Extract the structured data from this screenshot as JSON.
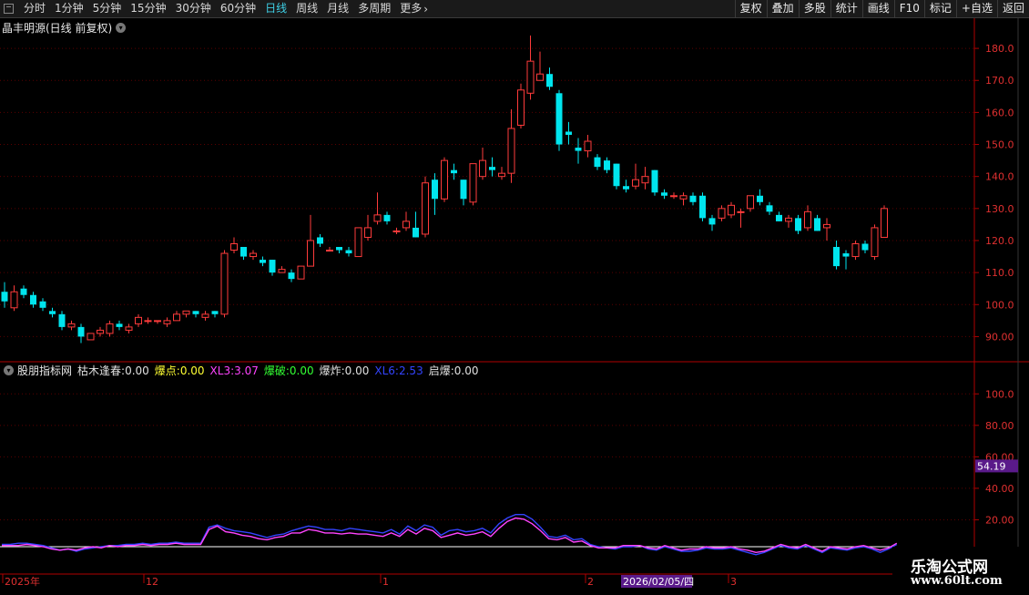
{
  "toolbar": {
    "tabs": [
      "分时",
      "1分钟",
      "5分钟",
      "15分钟",
      "30分钟",
      "60分钟",
      "日线",
      "周线",
      "月线",
      "多周期",
      "更多"
    ],
    "active_tab": "日线",
    "buttons": [
      "复权",
      "叠加",
      "多股",
      "统计",
      "画线",
      "F10",
      "标记",
      "+自选",
      "返回"
    ]
  },
  "main_panel": {
    "title": "晶丰明源(日线 前复权)",
    "y_ticks": [
      "180.0",
      "170.0",
      "160.0",
      "150.0",
      "140.0",
      "130.0",
      "120.0",
      "110.0",
      "100.0",
      "90.00"
    ]
  },
  "indicator_panel": {
    "title": "股朋指标网",
    "items": [
      {
        "label": "枯木逢春:",
        "value": "0.00",
        "color": "#e0e0e0"
      },
      {
        "label": "爆点:",
        "value": "0.00",
        "color": "#ffff33"
      },
      {
        "label": "XL3:",
        "value": "3.07",
        "color": "#ff44ff"
      },
      {
        "label": "爆破:",
        "value": "0.00",
        "color": "#33ff33"
      },
      {
        "label": "爆炸:",
        "value": "0.00",
        "color": "#e0e0e0"
      },
      {
        "label": "XL6:",
        "value": "2.53",
        "color": "#3344ff"
      },
      {
        "label": "启爆:",
        "value": "0.00",
        "color": "#e0e0e0"
      }
    ],
    "y_ticks": [
      "100.0",
      "80.00",
      "60.00",
      "40.00",
      "20.00"
    ],
    "current_value": "54.19"
  },
  "x_axis": {
    "labels": [
      "2025年",
      "12",
      "1",
      "2",
      "3"
    ],
    "cursor_date": "2026/02/05/四"
  },
  "watermark": {
    "line1": "乐淘公式网",
    "line2": "www.60lt.com"
  },
  "colors": {
    "up": "#ff3b3b",
    "down": "#00e5ee",
    "xl3": "#ff44ff",
    "xl6": "#3344ff",
    "grid": "#5a0000",
    "axis": "#b00000"
  },
  "chart_data": [
    {
      "type": "candlestick",
      "title": "晶丰明源(日线 前复权)",
      "ylim": [
        85,
        186
      ],
      "candles": [
        {
          "o": 104,
          "h": 107,
          "l": 99,
          "c": 101
        },
        {
          "o": 99,
          "h": 106,
          "l": 98,
          "c": 104
        },
        {
          "o": 105,
          "h": 106,
          "l": 102,
          "c": 103
        },
        {
          "o": 103,
          "h": 104,
          "l": 99,
          "c": 100
        },
        {
          "o": 101,
          "h": 102,
          "l": 98,
          "c": 99
        },
        {
          "o": 98,
          "h": 99,
          "l": 96,
          "c": 97
        },
        {
          "o": 97,
          "h": 98,
          "l": 92,
          "c": 93
        },
        {
          "o": 93,
          "h": 95,
          "l": 92,
          "c": 94
        },
        {
          "o": 93,
          "h": 94,
          "l": 88,
          "c": 90
        },
        {
          "o": 89,
          "h": 91,
          "l": 89,
          "c": 91
        },
        {
          "o": 91,
          "h": 93,
          "l": 90,
          "c": 92
        },
        {
          "o": 91,
          "h": 95,
          "l": 90,
          "c": 94
        },
        {
          "o": 94,
          "h": 95,
          "l": 92,
          "c": 93
        },
        {
          "o": 92,
          "h": 94,
          "l": 91,
          "c": 93
        },
        {
          "o": 94,
          "h": 97,
          "l": 93,
          "c": 96
        },
        {
          "o": 95,
          "h": 96,
          "l": 94,
          "c": 95
        },
        {
          "o": 95,
          "h": 95,
          "l": 94,
          "c": 95
        },
        {
          "o": 94,
          "h": 96,
          "l": 93,
          "c": 95
        },
        {
          "o": 95,
          "h": 98,
          "l": 95,
          "c": 97
        },
        {
          "o": 97,
          "h": 98,
          "l": 96,
          "c": 98
        },
        {
          "o": 98,
          "h": 98,
          "l": 96,
          "c": 97
        },
        {
          "o": 96,
          "h": 98,
          "l": 95,
          "c": 97
        },
        {
          "o": 98,
          "h": 98,
          "l": 96,
          "c": 97
        },
        {
          "o": 97,
          "h": 117,
          "l": 96,
          "c": 116
        },
        {
          "o": 117,
          "h": 121,
          "l": 116,
          "c": 119
        },
        {
          "o": 118,
          "h": 118,
          "l": 114,
          "c": 115
        },
        {
          "o": 115,
          "h": 117,
          "l": 114,
          "c": 116
        },
        {
          "o": 114,
          "h": 115,
          "l": 112,
          "c": 113
        },
        {
          "o": 114,
          "h": 114,
          "l": 109,
          "c": 110
        },
        {
          "o": 110,
          "h": 112,
          "l": 110,
          "c": 111
        },
        {
          "o": 110,
          "h": 111,
          "l": 107,
          "c": 108
        },
        {
          "o": 108,
          "h": 112,
          "l": 108,
          "c": 112
        },
        {
          "o": 112,
          "h": 128,
          "l": 112,
          "c": 120
        },
        {
          "o": 121,
          "h": 122,
          "l": 118,
          "c": 119
        },
        {
          "o": 117,
          "h": 118,
          "l": 117,
          "c": 117
        },
        {
          "o": 118,
          "h": 118,
          "l": 116,
          "c": 117
        },
        {
          "o": 117,
          "h": 118,
          "l": 115,
          "c": 116
        },
        {
          "o": 115,
          "h": 124,
          "l": 115,
          "c": 124
        },
        {
          "o": 121,
          "h": 128,
          "l": 120,
          "c": 124
        },
        {
          "o": 126,
          "h": 135,
          "l": 125,
          "c": 128
        },
        {
          "o": 128,
          "h": 129,
          "l": 125,
          "c": 126
        },
        {
          "o": 123,
          "h": 124,
          "l": 122,
          "c": 123
        },
        {
          "o": 124,
          "h": 129,
          "l": 123,
          "c": 126
        },
        {
          "o": 124,
          "h": 129,
          "l": 121,
          "c": 121
        },
        {
          "o": 122,
          "h": 140,
          "l": 121,
          "c": 138
        },
        {
          "o": 139,
          "h": 141,
          "l": 128,
          "c": 133
        },
        {
          "o": 133,
          "h": 146,
          "l": 132,
          "c": 145
        },
        {
          "o": 142,
          "h": 144,
          "l": 139,
          "c": 141
        },
        {
          "o": 139,
          "h": 139,
          "l": 131,
          "c": 133
        },
        {
          "o": 132,
          "h": 142,
          "l": 131,
          "c": 144
        },
        {
          "o": 140,
          "h": 149,
          "l": 139,
          "c": 145
        },
        {
          "o": 143,
          "h": 146,
          "l": 140,
          "c": 142
        },
        {
          "o": 140,
          "h": 143,
          "l": 139,
          "c": 141
        },
        {
          "o": 141,
          "h": 161,
          "l": 138,
          "c": 155
        },
        {
          "o": 156,
          "h": 169,
          "l": 155,
          "c": 167
        },
        {
          "o": 166,
          "h": 184,
          "l": 164,
          "c": 176
        },
        {
          "o": 170,
          "h": 179,
          "l": 170,
          "c": 172
        },
        {
          "o": 172,
          "h": 174,
          "l": 167,
          "c": 168
        },
        {
          "o": 166,
          "h": 167,
          "l": 148,
          "c": 150
        },
        {
          "o": 154,
          "h": 157,
          "l": 150,
          "c": 153
        },
        {
          "o": 149,
          "h": 152,
          "l": 144,
          "c": 148
        },
        {
          "o": 148,
          "h": 153,
          "l": 146,
          "c": 151
        },
        {
          "o": 146,
          "h": 147,
          "l": 142,
          "c": 143
        },
        {
          "o": 145,
          "h": 146,
          "l": 141,
          "c": 142
        },
        {
          "o": 144,
          "h": 144,
          "l": 136,
          "c": 137
        },
        {
          "o": 137,
          "h": 139,
          "l": 135,
          "c": 136
        },
        {
          "o": 137,
          "h": 144,
          "l": 136,
          "c": 139
        },
        {
          "o": 138,
          "h": 143,
          "l": 136,
          "c": 140
        },
        {
          "o": 142,
          "h": 142,
          "l": 134,
          "c": 135
        },
        {
          "o": 135,
          "h": 136,
          "l": 133,
          "c": 134
        },
        {
          "o": 134,
          "h": 135,
          "l": 133,
          "c": 134
        },
        {
          "o": 133,
          "h": 135,
          "l": 131,
          "c": 134
        },
        {
          "o": 134,
          "h": 135,
          "l": 131,
          "c": 132
        },
        {
          "o": 134,
          "h": 135,
          "l": 126,
          "c": 127
        },
        {
          "o": 127,
          "h": 128,
          "l": 123,
          "c": 125
        },
        {
          "o": 127,
          "h": 131,
          "l": 126,
          "c": 130
        },
        {
          "o": 128,
          "h": 132,
          "l": 127,
          "c": 131
        },
        {
          "o": 129,
          "h": 130,
          "l": 124,
          "c": 129
        },
        {
          "o": 130,
          "h": 134,
          "l": 129,
          "c": 134
        },
        {
          "o": 134,
          "h": 136,
          "l": 131,
          "c": 132
        },
        {
          "o": 131,
          "h": 132,
          "l": 128,
          "c": 129
        },
        {
          "o": 128,
          "h": 129,
          "l": 126,
          "c": 126
        },
        {
          "o": 126,
          "h": 128,
          "l": 124,
          "c": 127
        },
        {
          "o": 127,
          "h": 128,
          "l": 122,
          "c": 123
        },
        {
          "o": 124,
          "h": 131,
          "l": 123,
          "c": 129
        },
        {
          "o": 127,
          "h": 128,
          "l": 123,
          "c": 123
        },
        {
          "o": 124,
          "h": 127,
          "l": 120,
          "c": 125
        },
        {
          "o": 118,
          "h": 120,
          "l": 111,
          "c": 112
        },
        {
          "o": 116,
          "h": 117,
          "l": 111,
          "c": 115
        },
        {
          "o": 115,
          "h": 120,
          "l": 114,
          "c": 119
        },
        {
          "o": 119,
          "h": 120,
          "l": 116,
          "c": 117
        },
        {
          "o": 115,
          "h": 125,
          "l": 114,
          "c": 124
        },
        {
          "o": 121,
          "h": 131,
          "l": 121,
          "c": 130
        }
      ]
    },
    {
      "type": "line",
      "title": "股朋指标网",
      "ylim": [
        0,
        110
      ],
      "series": [
        {
          "name": "XL6",
          "values": [
            2,
            2,
            3,
            3,
            2,
            1,
            -1,
            -3,
            -2,
            -4,
            -2,
            -1,
            0,
            1,
            1,
            2,
            2,
            3,
            2,
            3,
            3,
            4,
            3,
            3,
            3,
            17,
            19,
            16,
            14,
            13,
            12,
            10,
            8,
            10,
            11,
            14,
            16,
            18,
            17,
            15,
            15,
            14,
            16,
            15,
            14,
            13,
            12,
            15,
            11,
            18,
            14,
            19,
            17,
            10,
            14,
            15,
            13,
            14,
            16,
            12,
            20,
            25,
            28,
            28,
            24,
            17,
            9,
            8,
            10,
            6,
            7,
            2,
            0,
            -1,
            -2,
            0,
            0,
            1,
            -2,
            -3,
            0,
            -2,
            -4,
            -4,
            -3,
            -1,
            -2,
            -2,
            -1,
            -3,
            -5,
            -7,
            -5,
            -2,
            1,
            -1,
            -2,
            1,
            -2,
            -5,
            -1,
            -2,
            -3,
            -1,
            0,
            -2,
            -5,
            -2,
            2
          ]
        },
        {
          "name": "XL3",
          "values": [
            1,
            1,
            1,
            2,
            1,
            0,
            -2,
            -3,
            -2,
            -3,
            -1,
            0,
            -1,
            1,
            0,
            1,
            1,
            2,
            1,
            2,
            2,
            3,
            2,
            2,
            2,
            15,
            18,
            13,
            12,
            10,
            9,
            7,
            6,
            8,
            9,
            12,
            12,
            15,
            14,
            12,
            12,
            11,
            12,
            11,
            11,
            10,
            9,
            12,
            9,
            15,
            11,
            16,
            14,
            8,
            10,
            12,
            10,
            11,
            13,
            9,
            16,
            22,
            25,
            24,
            20,
            14,
            7,
            6,
            8,
            4,
            5,
            1,
            -1,
            -1,
            -1,
            1,
            1,
            1,
            -1,
            -2,
            1,
            -1,
            -3,
            -2,
            -2,
            0,
            -1,
            -1,
            0,
            -2,
            -3,
            -5,
            -4,
            -1,
            2,
            0,
            -1,
            2,
            -1,
            -4,
            0,
            -1,
            -2,
            0,
            1,
            -1,
            -3,
            -1,
            3
          ]
        }
      ],
      "current_value": 54.19
    }
  ]
}
